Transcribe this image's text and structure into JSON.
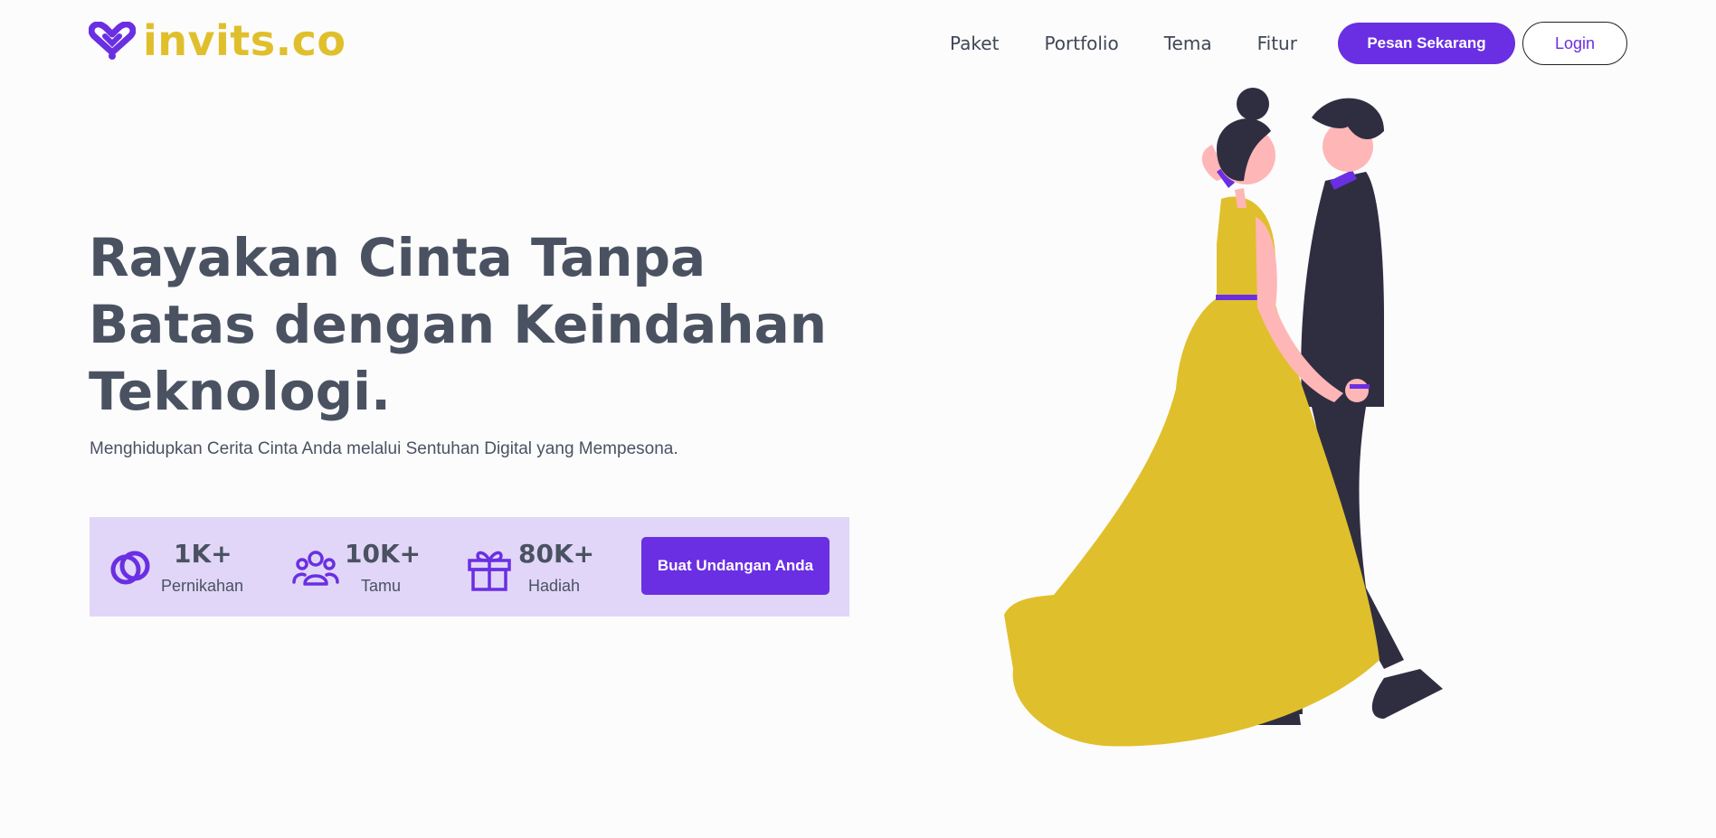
{
  "brand": {
    "name": "invits.co",
    "accent": "#6a2fe2",
    "logo_color": "#e0bf2c"
  },
  "nav": {
    "items": [
      {
        "label": "Paket"
      },
      {
        "label": "Portfolio"
      },
      {
        "label": "Tema"
      },
      {
        "label": "Fitur"
      }
    ],
    "primary_button": "Pesan Sekarang",
    "login_button": "Login"
  },
  "hero": {
    "title": "Rayakan Cinta Tanpa Batas dengan Keindahan Teknologi.",
    "subtitle": "Menghidupkan Cerita Cinta Anda melalui Sentuhan Digital yang Mempesona."
  },
  "stats": [
    {
      "icon": "rings-icon",
      "value": "1K+",
      "label": "Pernikahan"
    },
    {
      "icon": "users-icon",
      "value": "10K+",
      "label": "Tamu"
    },
    {
      "icon": "gift-icon",
      "value": "80K+",
      "label": "Hadiah"
    }
  ],
  "cta": {
    "label": "Buat Undangan Anda"
  },
  "illustration": {
    "icon": "dancing-couple-illustration",
    "dress_color": "#e0bf2c",
    "suit_color": "#2f2e41"
  }
}
